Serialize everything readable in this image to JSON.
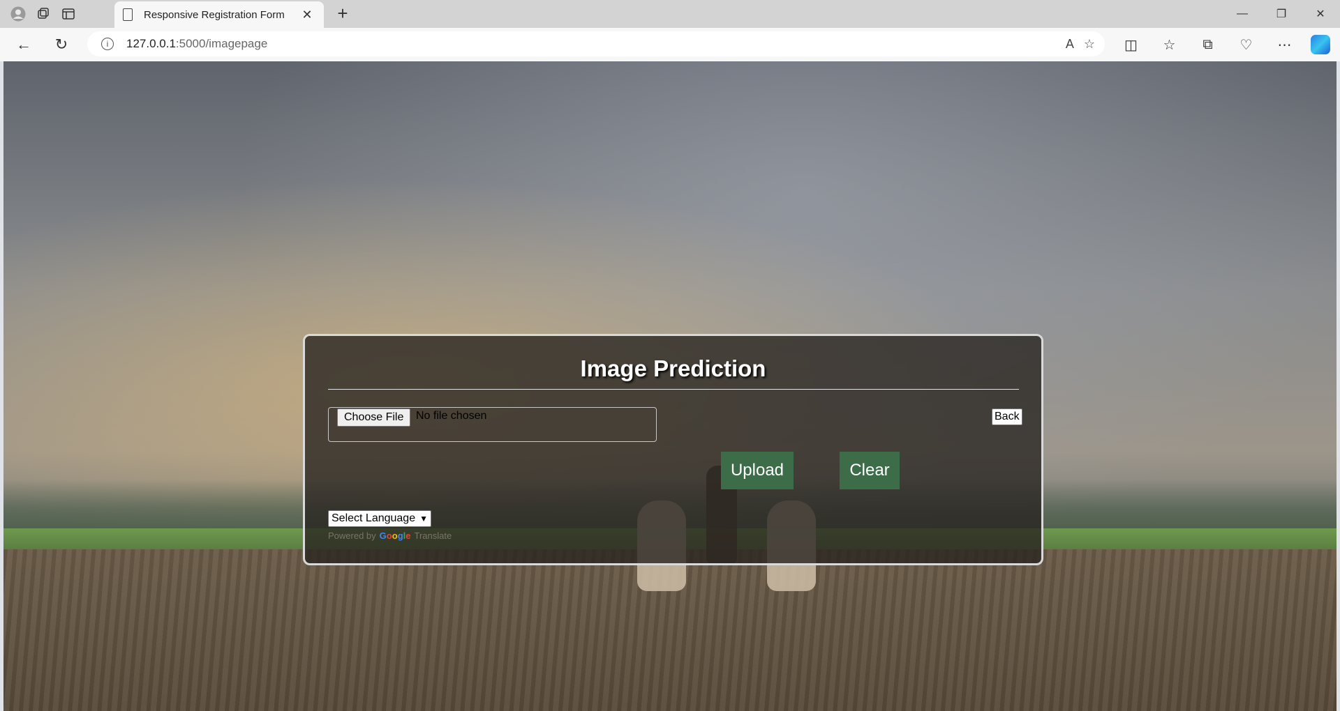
{
  "browser": {
    "tab_title": "Responsive Registration Form",
    "url_host": "127.0.0.1",
    "url_path": ":5000/imagepage",
    "icons": {
      "profile": "profile-icon",
      "workspaces": "workspaces-icon",
      "tab_actions": "tab-actions-icon",
      "back": "back-arrow-icon",
      "reload": "reload-icon",
      "info": "info-icon",
      "read_aloud": "read-aloud-icon",
      "favorite": "star-icon",
      "split_screen": "split-screen-icon",
      "favorites": "favorites-icon",
      "collections": "collections-icon",
      "browser_essentials": "heart-pulse-icon",
      "more": "more-icon",
      "copilot": "copilot-icon"
    }
  },
  "page": {
    "title": "Image Prediction",
    "file_input": {
      "button_label": "Choose File",
      "status": "No file chosen"
    },
    "back_label": "Back",
    "upload_label": "Upload",
    "clear_label": "Clear",
    "language_select": "Select Language",
    "translate": {
      "powered_by": "Powered by",
      "google": "Google",
      "translate": "Translate"
    },
    "colors": {
      "action_button": "#3c6d48",
      "panel_bg": "rgba(40,36,32,0.78)"
    }
  }
}
